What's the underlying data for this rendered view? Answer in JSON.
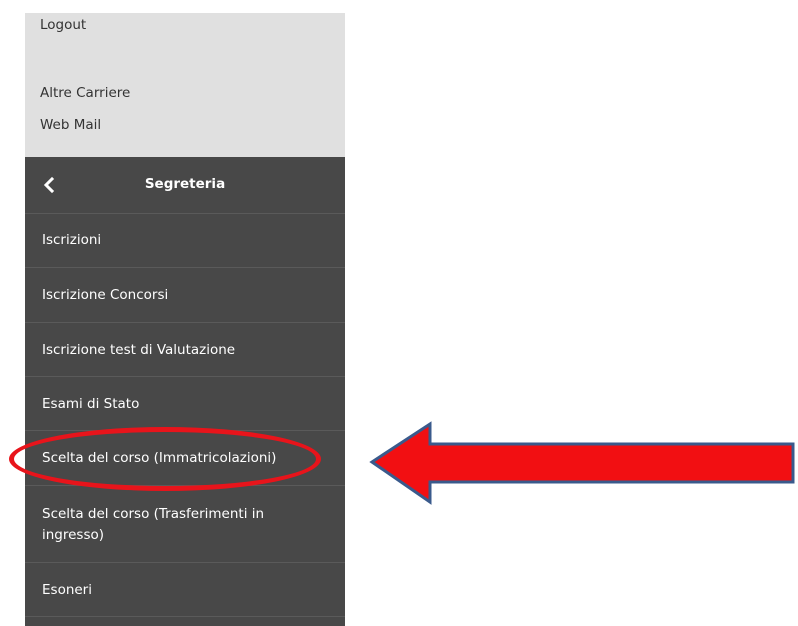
{
  "top_links": [
    {
      "label": "Logout"
    },
    {
      "label": "Altre Carriere"
    },
    {
      "label": "Web Mail"
    }
  ],
  "menu": {
    "title": "Segreteria",
    "back_icon": "chevron-left-icon",
    "items": [
      {
        "label": "Iscrizioni"
      },
      {
        "label": "Iscrizione Concorsi"
      },
      {
        "label": "Iscrizione test di Valutazione"
      },
      {
        "label": "Esami di Stato"
      },
      {
        "label": "Scelta del corso (Immatricolazioni)"
      },
      {
        "label": "Scelta del corso (Trasferimenti in ingresso)"
      },
      {
        "label": "Esoneri"
      }
    ]
  },
  "annotation": {
    "highlight_color": "#e8141b",
    "arrow_fill": "#f20f12",
    "arrow_stroke": "#3a5a8c"
  },
  "colors": {
    "top_panel_bg": "#e0e0e0",
    "menu_bg": "#484848",
    "menu_text": "#ffffff"
  }
}
